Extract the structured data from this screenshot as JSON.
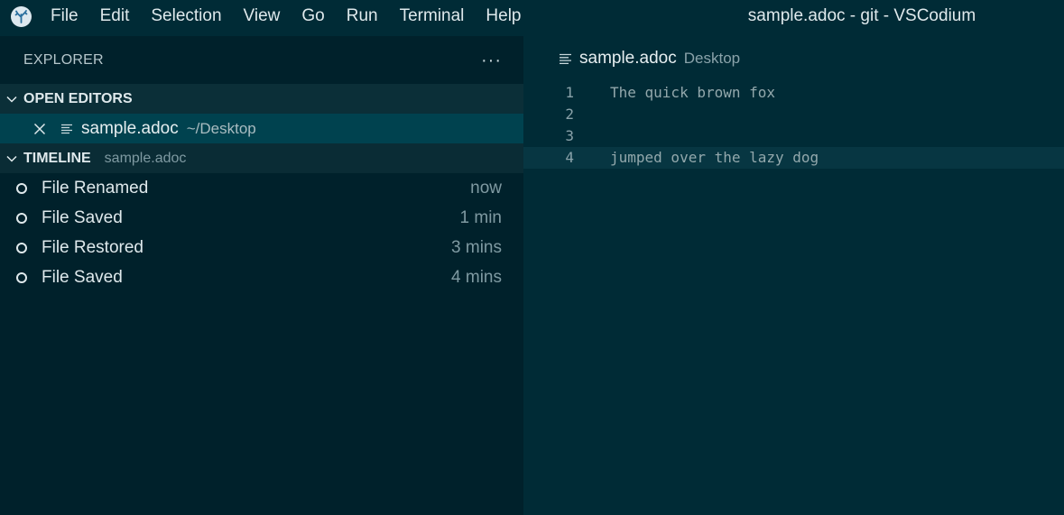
{
  "window": {
    "title": "sample.adoc - git - VSCodium"
  },
  "menu": [
    "File",
    "Edit",
    "Selection",
    "View",
    "Go",
    "Run",
    "Terminal",
    "Help"
  ],
  "sidebar": {
    "title": "EXPLORER",
    "more_label": "···",
    "open_editors": {
      "title": "OPEN EDITORS",
      "items": [
        {
          "name": "sample.adoc",
          "path": "~/Desktop"
        }
      ]
    },
    "timeline": {
      "title": "TIMELINE",
      "subtitle": "sample.adoc",
      "items": [
        {
          "label": "File Renamed",
          "time": "now"
        },
        {
          "label": "File Saved",
          "time": "1 min"
        },
        {
          "label": "File Restored",
          "time": "3 mins"
        },
        {
          "label": "File Saved",
          "time": "4 mins"
        }
      ]
    }
  },
  "editor": {
    "breadcrumb": {
      "file": "sample.adoc",
      "dir": "Desktop"
    },
    "lines": [
      {
        "num": "1",
        "text": "The quick brown fox"
      },
      {
        "num": "2",
        "text": ""
      },
      {
        "num": "3",
        "text": ""
      },
      {
        "num": "4",
        "text": "jumped over the lazy dog"
      }
    ],
    "current_line": 4
  },
  "colors": {
    "background": "#002b36",
    "sidebar": "#00212b",
    "selection": "#00424f",
    "current_line": "#073642"
  }
}
